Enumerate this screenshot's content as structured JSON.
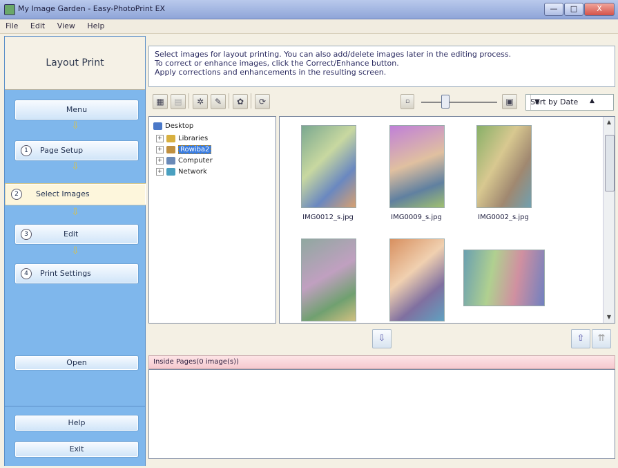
{
  "window": {
    "title": "My Image Garden - Easy-PhotoPrint EX",
    "minimize_label": "—",
    "maximize_label": "□",
    "close_label": "X"
  },
  "menu": {
    "items": [
      "File",
      "Edit",
      "View",
      "Help"
    ]
  },
  "sidebar": {
    "header": "Layout Print",
    "steps": [
      {
        "label": "Menu",
        "number": ""
      },
      {
        "label": "Page Setup",
        "number": "1"
      },
      {
        "label": "Select Images",
        "number": "2"
      },
      {
        "label": "Edit",
        "number": "3"
      },
      {
        "label": "Print Settings",
        "number": "4"
      }
    ],
    "open_label": "Open",
    "help_label": "Help",
    "exit_label": "Exit"
  },
  "instructions": [
    "Select images for layout printing. You can also add/delete images later in the editing process.",
    "To correct or enhance images, click the Correct/Enhance button.",
    "Apply corrections and enhancements in the resulting screen."
  ],
  "toolbar": {
    "sort_label": "Sort by Date",
    "sort_arrow": "▲",
    "dropdown_arrow": "▼"
  },
  "tree": {
    "items": [
      {
        "label": "Desktop",
        "color": "#4a78c8"
      },
      {
        "label": "Libraries",
        "color": "#d8b040"
      },
      {
        "label": "Rowiba2",
        "color": "#c09040"
      },
      {
        "label": "Computer",
        "color": "#6a8ab8"
      },
      {
        "label": "Network",
        "color": "#4aa0c0"
      }
    ]
  },
  "thumbnails": [
    {
      "caption": "IMG0012_s.jpg",
      "color": "#7aa890"
    },
    {
      "caption": "IMG0009_s.jpg",
      "color": "#b070c8"
    },
    {
      "caption": "IMG0002_s.jpg",
      "color": "#88b068"
    },
    {
      "caption": "",
      "color": "#90a8a0"
    },
    {
      "caption": "",
      "color": "#d89060"
    },
    {
      "caption": "",
      "color": "#6aa0b0"
    }
  ],
  "inside_pages": {
    "header": "Inside Pages(0 image(s))"
  }
}
